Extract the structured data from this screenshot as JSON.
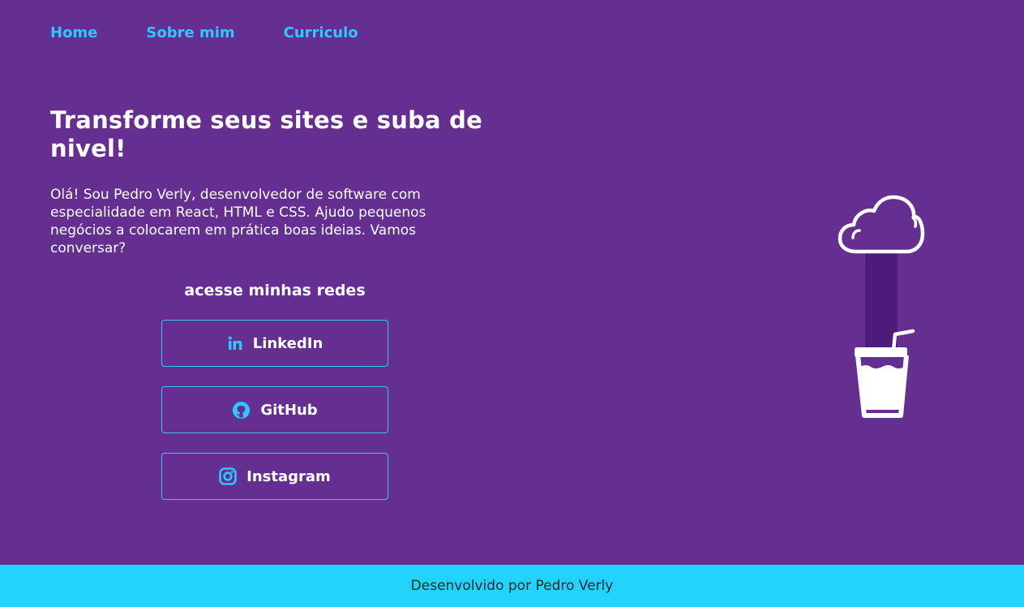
{
  "nav": {
    "items": [
      {
        "label": "Home"
      },
      {
        "label": "Sobre mim"
      },
      {
        "label": "Curriculo"
      }
    ]
  },
  "hero": {
    "headline": "Transforme seus sites e suba de nivel!",
    "intro": "Olá! Sou Pedro Verly, desenvolvedor de software com especialidade em React, HTML e CSS. Ajudo pequenos negócios a colocarem em prática boas ideias. Vamos conversar?"
  },
  "social": {
    "title": "acesse minhas redes",
    "links": [
      {
        "label": "LinkedIn",
        "icon": "linkedin-icon"
      },
      {
        "label": "GitHub",
        "icon": "github-icon"
      },
      {
        "label": "Instagram",
        "icon": "instagram-icon"
      }
    ]
  },
  "illustration": {
    "icon": "cloud-drink-icon"
  },
  "footer": {
    "text": "Desenvolvido por Pedro Verly"
  },
  "colors": {
    "background": "#652f92",
    "accent": "#2ec8ff",
    "footer": "#22d3fe",
    "text": "#ffffff"
  }
}
